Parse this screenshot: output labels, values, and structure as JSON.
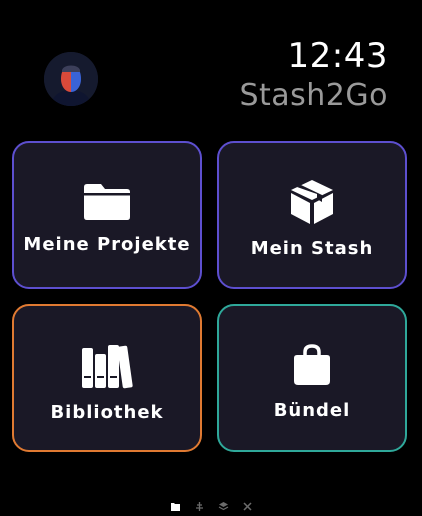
{
  "header": {
    "time": "12:43",
    "app_title": "Stash2Go",
    "avatar_icon": "profile-photo"
  },
  "tiles": [
    {
      "label": "Meine Projekte",
      "icon": "folder-icon",
      "accent": "#5d4fcf"
    },
    {
      "label": "Mein Stash",
      "icon": "box-icon",
      "accent": "#5d4fcf"
    },
    {
      "label": "Bibliothek",
      "icon": "books-icon",
      "accent": "#e07a32"
    },
    {
      "label": "Bündel",
      "icon": "bag-icon",
      "accent": "#2fa89a"
    }
  ],
  "page_indicator": {
    "icons": [
      "folder-icon",
      "needle-icon",
      "layers-icon",
      "tools-icon"
    ],
    "active_index": 0
  }
}
